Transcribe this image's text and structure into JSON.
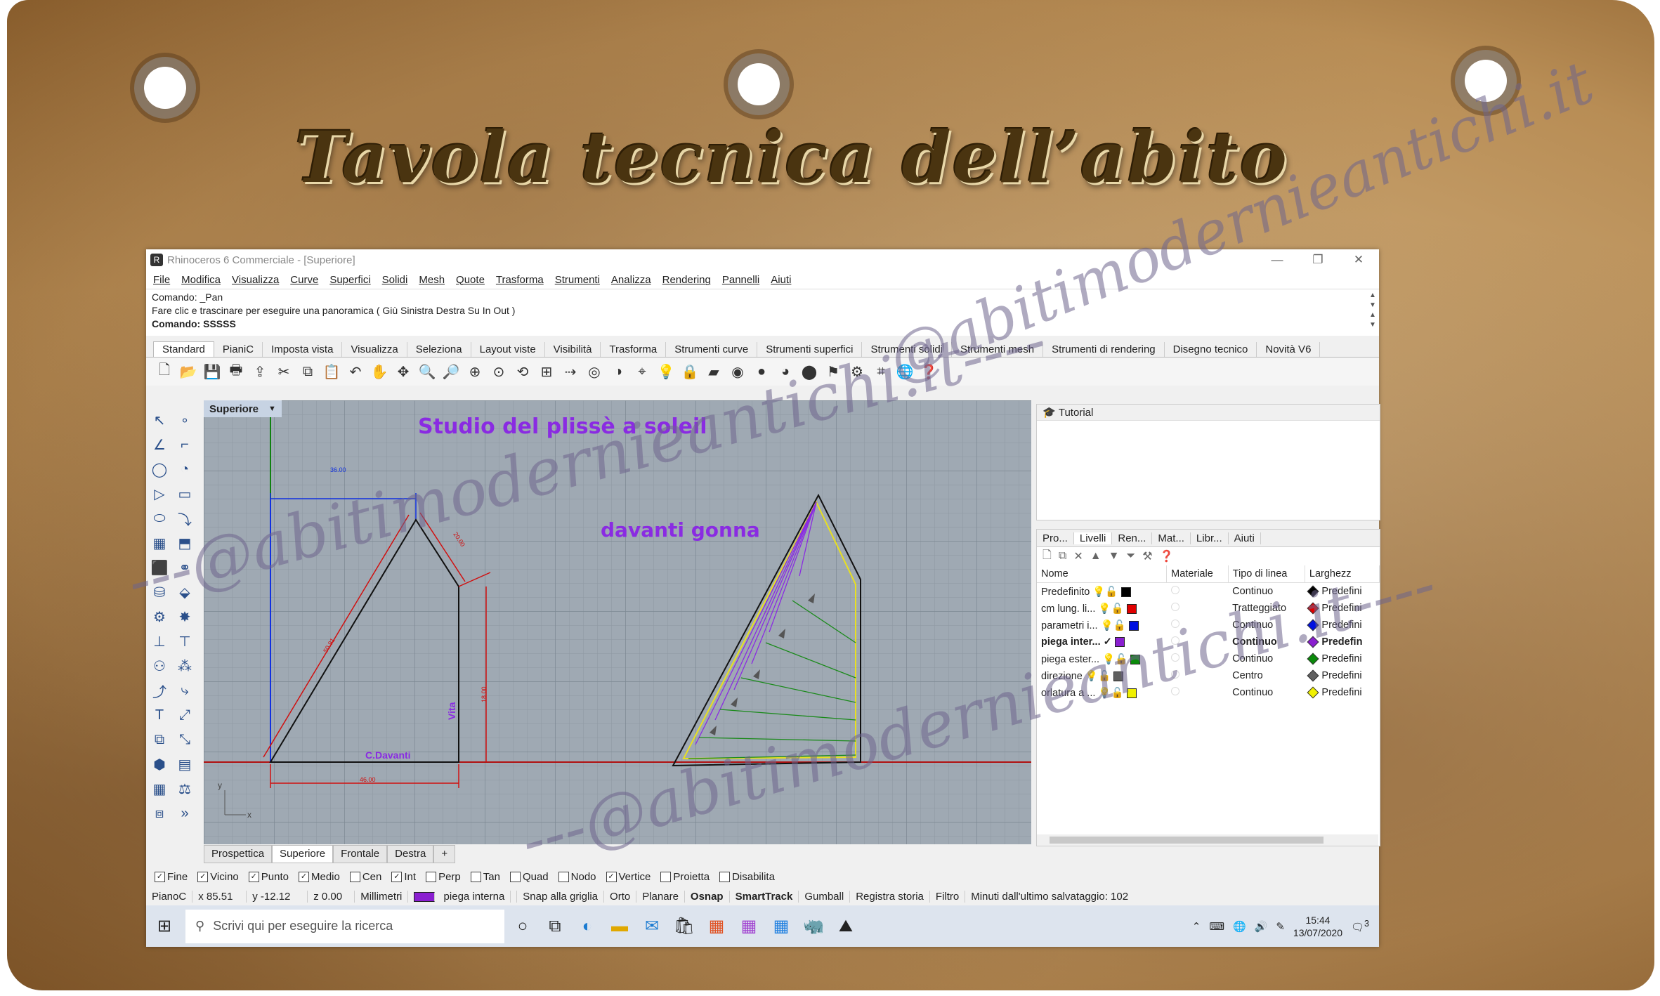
{
  "page": {
    "title": "Tavola tecnica dell’abito"
  },
  "watermarks": [
    "---@abitimodernieantichi.it----",
    "---@abitimodernieantichi.it----",
    "@abitimodernieantichi.it"
  ],
  "window": {
    "title": "Rhinoceros 6 Commerciale - [Superiore]",
    "controls": [
      "—",
      "❐",
      "✕"
    ]
  },
  "menu": [
    "File",
    "Modifica",
    "Visualizza",
    "Curve",
    "Superfici",
    "Solidi",
    "Mesh",
    "Quote",
    "Trasforma",
    "Strumenti",
    "Analizza",
    "Rendering",
    "Pannelli",
    "Aiuti"
  ],
  "command": {
    "line1": "Comando: _Pan",
    "line2": "Fare clic e trascinare per eseguire una panoramica ( Giù  Sinistra  Destra  Su  In  Out )",
    "line3": "Comando: SSSSS"
  },
  "ribbon_tabs": [
    "Standard",
    "PianiC",
    "Imposta vista",
    "Visualizza",
    "Seleziona",
    "Layout viste",
    "Visibilità",
    "Trasforma",
    "Strumenti curve",
    "Strumenti superfici",
    "Strumenti solidi",
    "Strumenti mesh",
    "Strumenti di rendering",
    "Disegno tecnico",
    "Novità V6"
  ],
  "viewport": {
    "name": "Superiore",
    "drawing_title": "Studio del plissè a soleil",
    "label_front": "davanti gonna",
    "label_cdavanti": "C.Davanti",
    "label_vita": "Vita",
    "dims": {
      "top": "36.00",
      "diag": "50.91",
      "side": "20.00",
      "right": "18.00",
      "bottom": "46.00"
    },
    "axis_y": "y",
    "axis_x": "x"
  },
  "view_tabs": [
    "Prospettica",
    "Superiore",
    "Frontale",
    "Destra",
    "+"
  ],
  "tutorial": {
    "label": "Tutorial"
  },
  "panel_tabs": [
    "Pro...",
    "Livelli",
    "Ren...",
    "Mat...",
    "Libr...",
    "Aiuti"
  ],
  "layers": {
    "headers": [
      "Nome",
      "Materiale",
      "Tipo di linea",
      "Larghezz"
    ],
    "rows": [
      {
        "name": "Predefinito",
        "color": "#000000",
        "linetype": "Continuo",
        "width": "Predefini",
        "bold": false
      },
      {
        "name": "cm lung. li...",
        "color": "#e00000",
        "linetype": "Tratteggiato",
        "width": "Predefini",
        "bold": false
      },
      {
        "name": "parametri i...",
        "color": "#0010e0",
        "linetype": "Continuo",
        "width": "Predefini",
        "bold": false
      },
      {
        "name": "piega inter...",
        "color": "#8a1fd0",
        "linetype": "Continuo",
        "width": "Predefin",
        "bold": true
      },
      {
        "name": "piega ester...",
        "color": "#0a8a0a",
        "linetype": "Continuo",
        "width": "Predefini",
        "bold": false
      },
      {
        "name": "direzione",
        "color": "#606060",
        "linetype": "Centro",
        "width": "Predefini",
        "bold": false
      },
      {
        "name": "orlatura a ...",
        "color": "#f0f000",
        "linetype": "Continuo",
        "width": "Predefini",
        "bold": false
      }
    ]
  },
  "osnap": [
    {
      "label": "Fine",
      "checked": true
    },
    {
      "label": "Vicino",
      "checked": true
    },
    {
      "label": "Punto",
      "checked": true
    },
    {
      "label": "Medio",
      "checked": true
    },
    {
      "label": "Cen",
      "checked": false
    },
    {
      "label": "Int",
      "checked": true
    },
    {
      "label": "Perp",
      "checked": false
    },
    {
      "label": "Tan",
      "checked": false
    },
    {
      "label": "Quad",
      "checked": false
    },
    {
      "label": "Nodo",
      "checked": false
    },
    {
      "label": "Vertice",
      "checked": true
    },
    {
      "label": "Proietta",
      "checked": false
    },
    {
      "label": "Disabilita",
      "checked": false
    }
  ],
  "status": {
    "cplane": "PianoC",
    "x": "x 85.51",
    "y": "y -12.12",
    "z": "z 0.00",
    "units": "Millimetri",
    "layer": "piega interna",
    "snap": "Snap alla griglia",
    "ortho": "Orto",
    "planar": "Planare",
    "osnap": "Osnap",
    "smarttrack": "SmartTrack",
    "gumball": "Gumball",
    "history": "Registra storia",
    "filter": "Filtro",
    "saved": "Minuti dall'ultimo salvataggio: 102"
  },
  "taskbar": {
    "search_placeholder": "Scrivi qui per eseguire la ricerca",
    "time": "15:44",
    "date": "13/07/2020",
    "notifications": "3"
  },
  "colors": {
    "accent_purple": "#8a2be2",
    "grid_bg": "#9fa9b3"
  }
}
